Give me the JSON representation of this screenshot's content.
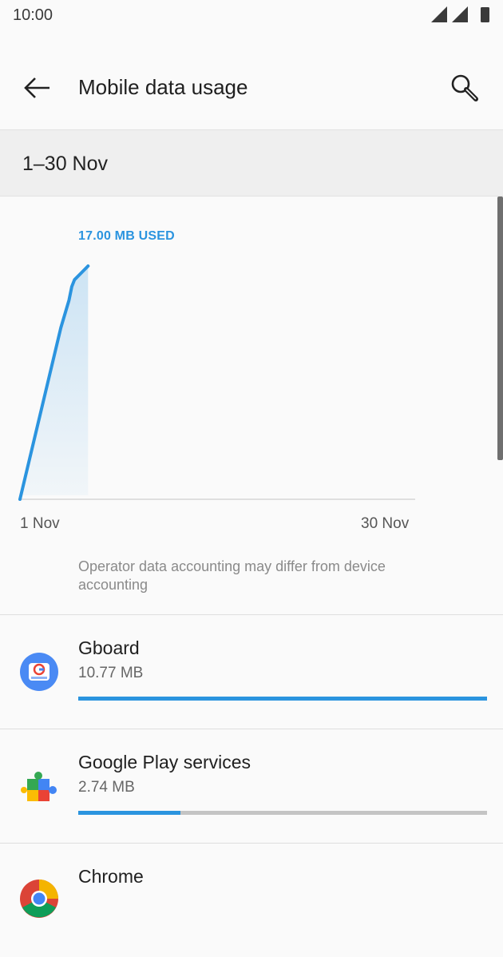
{
  "status_bar": {
    "time": "10:00",
    "icons": [
      "signal-icon",
      "signal-icon",
      "battery-icon"
    ]
  },
  "app_bar": {
    "title": "Mobile data usage",
    "back_icon": "back-arrow-icon",
    "search_icon": "search-icon"
  },
  "period": {
    "label": "1–30 Nov"
  },
  "summary": {
    "used_label": "17.00 MB USED"
  },
  "chart_data": {
    "type": "area",
    "x_start_label": "1 Nov",
    "x_end_label": "30 Nov",
    "x": [
      1,
      4,
      4.6,
      4.8,
      5,
      5.5,
      6
    ],
    "y": [
      0,
      12.5,
      14.5,
      15.5,
      16.0,
      16.5,
      17.0
    ],
    "xlim": [
      1,
      30
    ],
    "ylim": [
      0,
      17
    ],
    "unit": "MB",
    "color": "#2b94df"
  },
  "disclaimer": "Operator data accounting may differ from device accounting",
  "apps": [
    {
      "name": "Gboard",
      "usage": "10.77 MB",
      "fraction": 1.0,
      "icon": "gboard-icon"
    },
    {
      "name": "Google Play services",
      "usage": "2.74 MB",
      "fraction": 0.25,
      "icon": "play-services-icon"
    },
    {
      "name": "Chrome",
      "usage": "",
      "fraction": 0,
      "icon": "chrome-icon"
    }
  ],
  "colors": {
    "accent": "#2b94df",
    "track": "#c4c4c4",
    "background": "#fafafa",
    "period_bar": "#efefef"
  }
}
